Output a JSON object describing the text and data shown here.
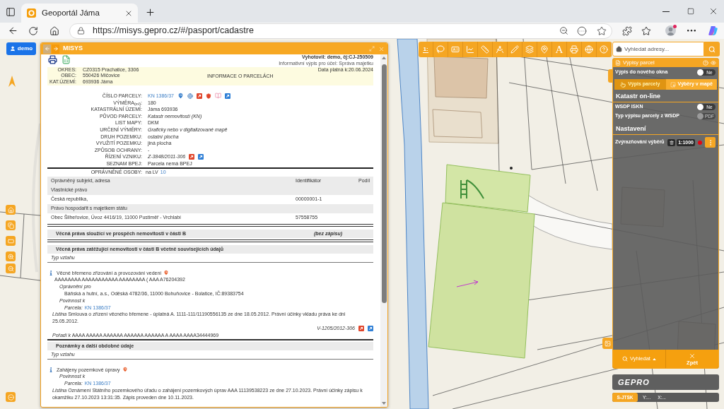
{
  "browser": {
    "tabs": [
      {
        "title": "Geoportál Jáma",
        "selected": true
      }
    ],
    "url": "https://misys.gepro.cz/#/pasport/cadastre"
  },
  "user_button": {
    "label": "demo"
  },
  "map_toolbar": [
    {
      "kind": "scale",
      "label": "1:"
    },
    {
      "kind": "lasso"
    },
    {
      "kind": "card"
    },
    {
      "kind": "profile"
    },
    {
      "kind": "measure"
    },
    {
      "kind": "angle"
    },
    {
      "kind": "draw"
    },
    {
      "kind": "layers"
    },
    {
      "kind": "marker"
    },
    {
      "kind": "text",
      "label": "A"
    },
    {
      "kind": "print"
    },
    {
      "kind": "globe"
    },
    {
      "kind": "help"
    }
  ],
  "address_search": {
    "placeholder": "Vyhledat adresy..."
  },
  "misys": {
    "title": "MISYS",
    "issued_by": "Vyhotovil: demo, čj:CJ-250509",
    "purpose": "Informativní výpis pro účel: Správa majetku",
    "location": [
      {
        "label": "OKRES:",
        "value": "CZ0315 Prachatice, 3306"
      },
      {
        "label": "OBEC:",
        "value": "550426 Mičovice"
      },
      {
        "label": "KAT.ÚZEMÍ:",
        "value": "693936 Jáma"
      }
    ],
    "report_title": "INFORMACE O PARCELÁCH",
    "valid_date": "Data platná k:20.06.2024",
    "parcel": [
      {
        "label": "ČÍSLO PARCELY:",
        "value": "KN 1386/37",
        "kind": "parcel_link"
      },
      {
        "label": "VÝMĚRA$_{(m²)}$:",
        "value": "180",
        "kind": "plain"
      },
      {
        "label": "KATASTRÁLNÍ ÚZEMÍ:",
        "value": "Jáma 693936",
        "kind": "plain"
      },
      {
        "label": "PŮVOD PARCELY:",
        "value": "Katastr nemovitostí (KN)",
        "kind": "italic"
      },
      {
        "label": "LIST MAPY:",
        "value": "DKM",
        "kind": "plain"
      },
      {
        "label": "URČENÍ VÝMĚRY:",
        "value": "Graficky nebo v digitalizované mapě",
        "kind": "italic"
      },
      {
        "label": "DRUH POZEMKU:",
        "value": "ostatní plocha",
        "kind": "italic"
      },
      {
        "label": "VYUŽITÍ POZEMKU:",
        "value": "jiná plocha",
        "kind": "plain"
      },
      {
        "label": "ZPŮSOB OCHRANY:",
        "value": "-",
        "kind": "plain"
      },
      {
        "label": "ŘÍZENÍ VZNIKU:",
        "value": "Z-3848/2011-306",
        "kind": "proceeding"
      },
      {
        "label": "SEZNAM BPEJ:",
        "value": "Parcela nemá BPEJ",
        "kind": "plain"
      }
    ],
    "owners": {
      "label": "OPRÁVNĚNÉ OSOBY:",
      "lv_prefix": "na LV",
      "lv_number": "10",
      "columns": [
        "Oprávněný subjekt, adresa",
        "Identifikátor",
        "Podíl"
      ],
      "rows": [
        {
          "kind": "group",
          "text": "Vlastnické právo"
        },
        {
          "kind": "entry",
          "subject": "Česká republika,",
          "identifier": "00000001-1"
        },
        {
          "kind": "group",
          "text": "Právo hospodařit s majetkem státu"
        },
        {
          "kind": "entry",
          "subject": "Obec Šilheřovice, Úvoz 4416/19, 11000 Pustiměř - Vrchlabí",
          "identifier": "57558755"
        }
      ]
    },
    "sections": [
      {
        "title": "Věcná práva sloužící ve prospěch nemovitosti v části B",
        "note": "(bez zápisu)"
      },
      {
        "title": "Věcná práva zatěžující nemovitosti v části B včetně souvisejících údajů",
        "relation_label": "Typ vztahu",
        "entries": [
          {
            "title": "Věcné břemeno zřizování a provozování vedení",
            "subtitle": "AAAAAAAA AAAAAAAAAAA AAAAAAAA ( AAA A76204392",
            "beneficiary_label": "Oprávnění pro",
            "beneficiary": "Báňská a hutní, a.s., Oděská 4782/36, 11000 Bohuňovice - Bolatice, IČ:89383754",
            "obligation_label": "Povinnost k",
            "parcel_label": "Parcela:",
            "parcel": "KN 1386/37",
            "deed": "*Listina* Smlouva o zřízení věcného břemene - úplatná A. 1111-111/11190556135 ze dne 18.05.2012. Právní účinky vkladu práva ke dni 25.05.2012.",
            "proceeding": "V-1205/2012-306",
            "order": "*Pořadí k* AAAA AAAAA AAAAAA AAAAAA AAAAAA A AAAA AAAA34444969"
          }
        ]
      },
      {
        "title": "Poznámky a další obdobné údaje",
        "relation_label": "Typ vztahu",
        "entries": [
          {
            "title": "Zahájeny pozemkové úpravy",
            "obligation_label": "Povinnost k",
            "parcel_label": "Parcela:",
            "parcel": "KN 1386/37",
            "deed": "*Listina* Oznámení Státního pozemkového úřadu o zahájení pozemkových úprav AAA 11139538223 ze dne 27.10.2023. Právní účinky zápisu k okamžiku 27.10.2023 13:31:35. Zápis proveden dne 10.11.2023."
          }
        ]
      }
    ]
  },
  "parcel_panel": {
    "title": "Výpisy parcel",
    "new_window": {
      "label": "Výpis do nového okna",
      "on": false,
      "state_label": "Ne"
    },
    "modes": [
      {
        "label": "Výpis parcely",
        "kind": "parcel",
        "selected": true
      },
      {
        "label": "Výběry v mapě",
        "kind": "map_selection",
        "selected": false
      }
    ],
    "sections": [
      {
        "title": "Katastr on-line",
        "rows": [
          {
            "kind": "toggle",
            "label": "WSDP ISKN",
            "on": false,
            "disabled": false,
            "state_label": "Ne"
          },
          {
            "kind": "toggle",
            "label": "Typ výpisu parcely z WSDP",
            "on": false,
            "disabled": true,
            "state_label": "PDF"
          }
        ]
      },
      {
        "title": "Nastavení",
        "rows": [
          {
            "kind": "highlight",
            "label": "Zvýrazňování výběrů",
            "scale": "1:1000",
            "color": "#e30613"
          }
        ]
      }
    ],
    "actions": [
      {
        "kind": "dropdown",
        "label": "Vyhledat"
      },
      {
        "kind": "close",
        "label": "Zpět"
      }
    ]
  },
  "logo": {
    "text": "GEPRO"
  },
  "coordinates": {
    "system": "S-JTSK",
    "y": "Y:...",
    "x": "X:..."
  }
}
